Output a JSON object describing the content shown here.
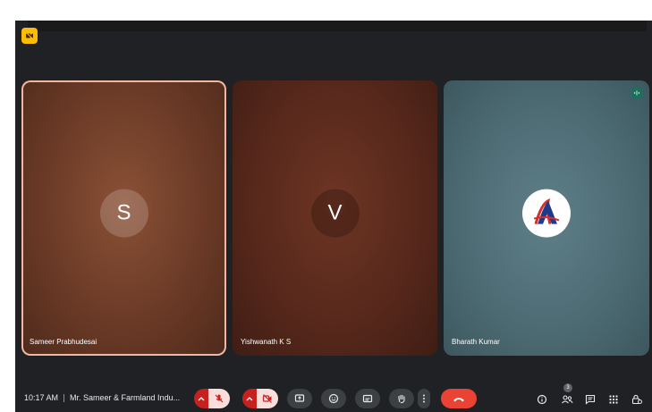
{
  "participants": [
    {
      "name": "Sameer Prabhudesai",
      "initial": "S"
    },
    {
      "name": "Yishwanath K S",
      "initial": "V"
    },
    {
      "name": "Bharath Kumar",
      "avatar_icon": "company-logo-icon"
    }
  ],
  "bottom_bar": {
    "time": "10:17 AM",
    "meeting_title": "Mr. Sameer & Farmland Indu...",
    "people_count": "3"
  },
  "icons": {
    "top_left": "no-video-badge-icon",
    "speaking": "speaking-indicator-icon",
    "mic": "mic-off-icon",
    "camera": "camera-off-icon",
    "present": "present-screen-icon",
    "emoji": "emoji-icon",
    "captions": "captions-icon",
    "raise_hand": "raise-hand-icon",
    "more": "more-options-icon",
    "hangup": "end-call-icon",
    "info": "info-icon",
    "people": "people-icon",
    "chat": "chat-icon",
    "activities": "activities-icon",
    "host_controls": "host-controls-icon"
  },
  "colors": {
    "background": "#202124",
    "hangup": "#ea4335",
    "muted_button": "#f9dedc",
    "badge": "#fbbc04"
  }
}
